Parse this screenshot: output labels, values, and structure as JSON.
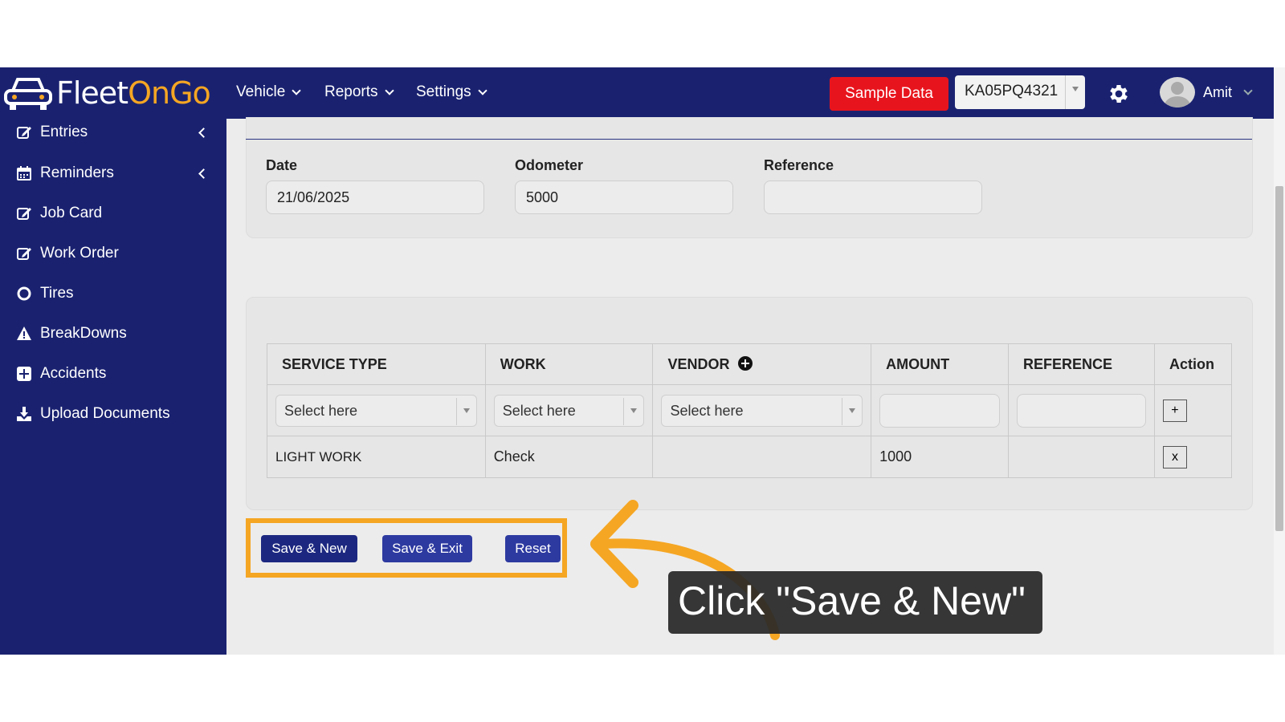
{
  "navbar": {
    "logo_text_white": "Fleet",
    "logo_text_orange": "OnGo",
    "menus": [
      "Vehicle",
      "Reports",
      "Settings"
    ],
    "sample_button": "Sample Data",
    "vehicle_select": "KA05PQ4321",
    "user_name": "Amit"
  },
  "sidebar": {
    "items": [
      {
        "label": "Entries",
        "icon": "edit-icon"
      },
      {
        "label": "Reminders",
        "icon": "calendar-icon"
      },
      {
        "label": "Job Card",
        "icon": "edit-icon"
      },
      {
        "label": "Work Order",
        "icon": "edit-icon"
      },
      {
        "label": "Tires",
        "icon": "circle-icon"
      },
      {
        "label": "BreakDowns",
        "icon": "warning-icon"
      },
      {
        "label": "Accidents",
        "icon": "plus-square-icon"
      },
      {
        "label": "Upload Documents",
        "icon": "download-icon"
      }
    ]
  },
  "form": {
    "date_label": "Date",
    "date_value": "21/06/2025",
    "odometer_label": "Odometer",
    "odometer_value": "5000",
    "reference_label": "Reference",
    "reference_value": ""
  },
  "table": {
    "headers": [
      "SERVICE TYPE",
      "WORK",
      "VENDOR",
      "AMOUNT",
      "REFERENCE",
      "Action"
    ],
    "select_placeholder": "Select here",
    "add_label": "+",
    "rows": [
      {
        "service_type": "LIGHT WORK",
        "work": "Check",
        "vendor": "",
        "amount": "1000",
        "reference": "",
        "action": "x"
      }
    ]
  },
  "buttons": {
    "save_new": "Save & New",
    "save_exit": "Save & Exit",
    "reset": "Reset"
  },
  "callout": {
    "text": "Click \"Save & New\""
  },
  "colors": {
    "navy": "#1a2270",
    "highlight": "#f5a623",
    "sample_red": "#e8141d",
    "button_dark": "#1c2880",
    "button_mid": "#2d3aa0"
  }
}
